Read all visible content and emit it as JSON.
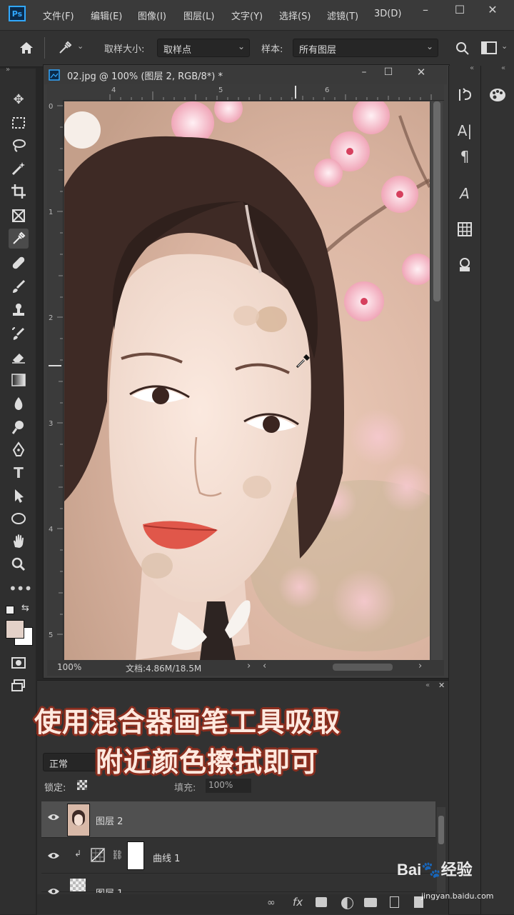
{
  "menubar": {
    "logo": "Ps",
    "items": [
      "文件(F)",
      "编辑(E)",
      "图像(I)",
      "图层(L)",
      "文字(Y)",
      "选择(S)",
      "滤镜(T)",
      "3D(D)"
    ],
    "window_controls": [
      "–",
      "☐",
      "✕"
    ]
  },
  "options": {
    "sample_size_label": "取样大小:",
    "sample_size_value": "取样点",
    "sample_label": "样本:",
    "sample_value": "所有图层"
  },
  "document": {
    "tab_title": "02.jpg @ 100% (图层 2, RGB/8*) *",
    "h_ruler_marks": [
      "4",
      "5",
      "6"
    ],
    "v_ruler_marks": [
      "0",
      "1",
      "2",
      "3",
      "4",
      "5"
    ],
    "zoom": "100%",
    "doc_size": "文档:4.86M/18.5M"
  },
  "layers": {
    "blend_mode": "正常",
    "lock_label": "锁定:",
    "fill_label": "填充:",
    "fill_value": "100%",
    "rows": [
      {
        "name": "图层 2"
      },
      {
        "name": "曲线 1"
      },
      {
        "name": "图层 1"
      }
    ]
  },
  "caption": {
    "line1": "使用混合器画笔工具吸取",
    "line2": "附近颜色擦拭即可"
  },
  "watermark": {
    "brand": "Bai🐾经验",
    "url": "jingyan.baidu.com"
  },
  "colors": {
    "foreground": "#e3d1c8",
    "background": "#ffffff",
    "accent": "#31a8ff"
  }
}
